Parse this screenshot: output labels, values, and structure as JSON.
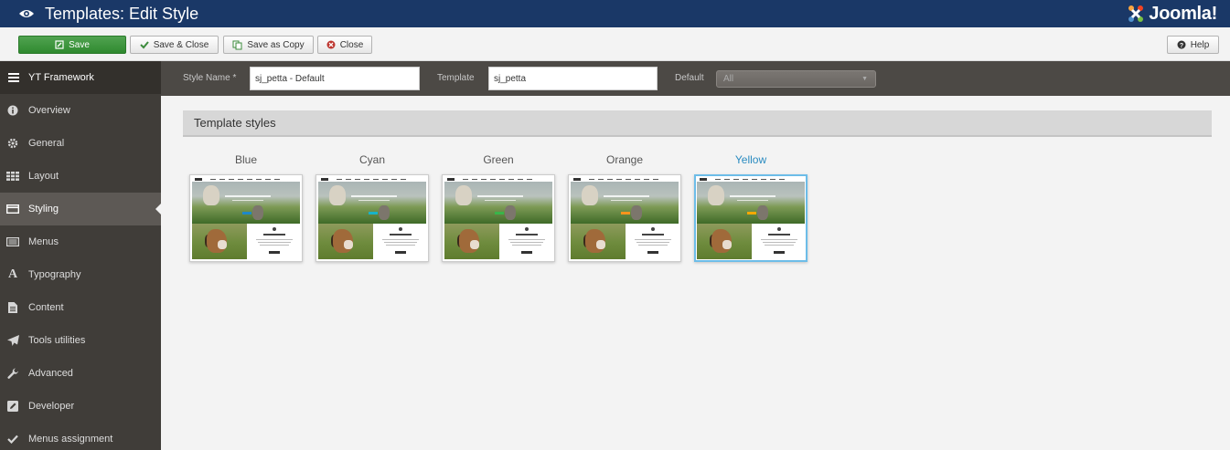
{
  "header": {
    "title": "Templates: Edit Style",
    "logo_text": "Joomla!"
  },
  "toolbar": {
    "save_label": "Save",
    "save_close_label": "Save & Close",
    "save_copy_label": "Save as Copy",
    "close_label": "Close",
    "help_label": "Help"
  },
  "sidebar": {
    "title": "YT Framework",
    "items": [
      {
        "label": "Overview",
        "icon": "info-icon"
      },
      {
        "label": "General",
        "icon": "gear-icon"
      },
      {
        "label": "Layout",
        "icon": "grid-icon"
      },
      {
        "label": "Styling",
        "icon": "card-icon",
        "active": true
      },
      {
        "label": "Menus",
        "icon": "list-icon"
      },
      {
        "label": "Typography",
        "icon": "font-icon"
      },
      {
        "label": "Content",
        "icon": "file-icon"
      },
      {
        "label": "Tools utilities",
        "icon": "paper-plane-icon"
      },
      {
        "label": "Advanced",
        "icon": "wrench-icon"
      },
      {
        "label": "Developer",
        "icon": "edit-icon"
      },
      {
        "label": "Menus assignment",
        "icon": "check-icon"
      }
    ]
  },
  "form": {
    "style_name_label": "Style Name *",
    "style_name_value": "sj_petta - Default",
    "template_label": "Template",
    "template_value": "sj_petta",
    "default_label": "Default",
    "default_value": "All"
  },
  "panel": {
    "title": "Template styles",
    "styles": [
      {
        "label": "Blue",
        "accent": "#1e88c8"
      },
      {
        "label": "Cyan",
        "accent": "#18b3c9"
      },
      {
        "label": "Green",
        "accent": "#39b54a"
      },
      {
        "label": "Orange",
        "accent": "#f7941d"
      },
      {
        "label": "Yellow",
        "accent": "#f5a800",
        "selected": true
      }
    ]
  },
  "colors": {
    "header_bg": "#1a3867",
    "sidebar_bg": "#403d39",
    "save_green": "#3c9a3c",
    "selected": "#2a8bc0"
  }
}
